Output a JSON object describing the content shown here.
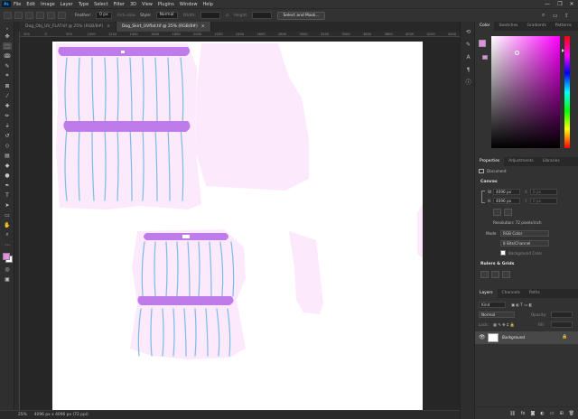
{
  "app": {
    "logo": "Ps",
    "menu": [
      "File",
      "Edit",
      "Image",
      "Layer",
      "Type",
      "Select",
      "Filter",
      "3D",
      "View",
      "Plugins",
      "Window",
      "Help"
    ],
    "window_controls": [
      "—",
      "❐",
      "✕"
    ]
  },
  "options_bar": {
    "feather_label": "Feather:",
    "feather_value": "0 px",
    "antialias_label": "Anti-alias",
    "style_label": "Style:",
    "style_value": "Normal",
    "width_label": "Width:",
    "height_label": "Height:",
    "select_mask_label": "Select and Mask..."
  },
  "tabs": [
    {
      "label": "Dog_Obj_UV_FLAT.tif @ 25% (RGB/8#)",
      "close": "×",
      "active": false
    },
    {
      "label": "Dog_Skirt_UVflat.tif @ 25% (RGB/8#)",
      "close": "×",
      "active": true
    }
  ],
  "ruler_ticks": [
    "500",
    "0",
    "500",
    "1000",
    "1200",
    "1400",
    "1600",
    "1800",
    "2000",
    "2200",
    "2400",
    "2600",
    "2800",
    "3000",
    "3200",
    "3400",
    "3600",
    "3800",
    "4000",
    "4200",
    "4400"
  ],
  "status": {
    "zoom": "25%",
    "doc_size": "4096 px x 4096 px (72 ppi)"
  },
  "colors": {
    "foreground": "#e98be6",
    "background": "#ffffff",
    "picker_hue": "#ff00ff",
    "skirt_band": "#c07bea",
    "skirt_fill": "#fbe9fb",
    "stripe": "#7bbbe6"
  },
  "color_panel": {
    "tabs": [
      "Color",
      "Swatches",
      "Gradients",
      "Patterns"
    ]
  },
  "properties_panel": {
    "tabs": [
      "Properties",
      "Adjustments",
      "Libraries"
    ],
    "kind": "Document",
    "canvas_title": "Canvas",
    "w_label": "W",
    "w_value": "4096 px",
    "h_label": "H",
    "h_value": "4096 px",
    "x_label": "X",
    "x_value": "0 px",
    "y_label": "Y",
    "y_value": "0 px",
    "resolution": "Resolution: 72 pixels/inch",
    "mode_label": "Mode",
    "mode_value": "RGB Color",
    "depth_value": "8 Bits/Channel",
    "bg_label": "Background Color",
    "rulers_title": "Rulers & Grids"
  },
  "layers_panel": {
    "tabs": [
      "Layers",
      "Channels",
      "Paths"
    ],
    "search_placeholder": "Kind",
    "blend_mode": "Normal",
    "opacity_label": "Opacity:",
    "lock_label": "Lock:",
    "fill_label": "Fill:",
    "layers": [
      {
        "name": "Background",
        "visible": true,
        "locked": true
      }
    ]
  }
}
